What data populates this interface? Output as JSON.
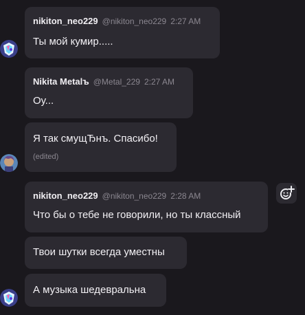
{
  "messages": [
    {
      "name": "nikiton_neo229",
      "handle": "@nikiton_neo229",
      "time": "2:27 AM",
      "texts": [
        "Ты мой кумир....."
      ]
    },
    {
      "name": "Nikita Metalъ",
      "handle": "@Metal_229",
      "time": "2:27 AM",
      "texts": [
        "Оу...",
        "Я так смущЂнъ. Спасибо!"
      ],
      "edited": "(edited)"
    },
    {
      "name": "nikiton_neo229",
      "handle": "@nikiton_neo229",
      "time": "2:28 AM",
      "texts": [
        "Что бы о тебе не говорили, но ты классный",
        "Твои шутки всегда уместны",
        "А музыка шедевральна"
      ]
    }
  ],
  "icons": [
    "avatar-nikiton",
    "avatar-metal",
    "add-reaction-icon"
  ],
  "colors": {
    "background": "#1a181d",
    "bubble": "#2c2a31",
    "text": "#f3f1f5",
    "muted": "#8b8790"
  }
}
